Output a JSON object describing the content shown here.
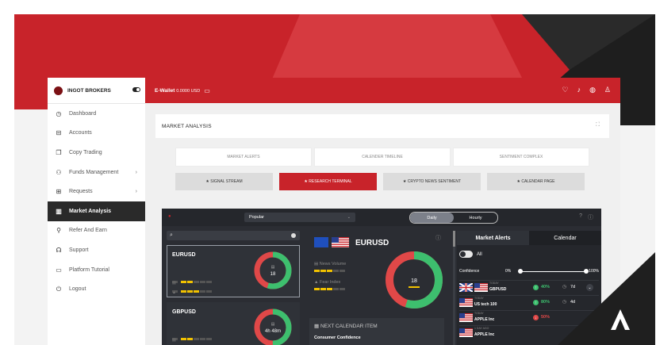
{
  "colors": {
    "brand_red": "#c8232a",
    "dark": "#2b2d33",
    "green": "#3dbf6e",
    "red": "#e04848",
    "yellow": "#f2c200"
  },
  "brand": {
    "name": "INGOT BROKERS"
  },
  "sidebar": {
    "items": [
      {
        "label": "Dashboard",
        "icon": "dashboard-icon"
      },
      {
        "label": "Accounts",
        "icon": "accounts-icon"
      },
      {
        "label": "Copy Trading",
        "icon": "copy-icon"
      },
      {
        "label": "Funds Management",
        "icon": "funds-icon",
        "chevron": "›"
      },
      {
        "label": "Requests",
        "icon": "requests-icon",
        "chevron": "›"
      },
      {
        "label": "Market Analysis",
        "icon": "chart-icon"
      },
      {
        "label": "Refer And Earn",
        "icon": "refer-icon"
      },
      {
        "label": "Support",
        "icon": "support-icon"
      },
      {
        "label": "Platform Tutorial",
        "icon": "tutorial-icon"
      },
      {
        "label": "Logout",
        "icon": "logout-icon"
      }
    ],
    "active": "Market Analysis"
  },
  "topbar": {
    "wallet_label": "E-Wallet",
    "wallet_amount": "0.0000 USD"
  },
  "main": {
    "title": "MARKET ANALYSIS",
    "tabs_row1": [
      "MARKET ALERTS",
      "CALENDER TIMELINE",
      "SENTIMENT COMPLEX"
    ],
    "tabs_row2": [
      {
        "label": "★ SIGNAL STREAM"
      },
      {
        "label": "★ RESEARCH TERMINAL",
        "active": true
      },
      {
        "label": "★ CRYPTO NEWS SENTIMENT"
      },
      {
        "label": "★ CALENDAR PAGE"
      }
    ]
  },
  "terminal": {
    "select_value": "Popular",
    "toggle": [
      "Daily",
      "Hourly"
    ],
    "toggle_selected": "Daily",
    "pairs": [
      {
        "name": "EURUSD",
        "timer": "18",
        "timer_unit": "h",
        "ring_green": 0.55
      },
      {
        "name": "GBPUSD",
        "timer": "4h 48m",
        "ring_green": 0.5
      }
    ],
    "detail": {
      "pair": "EURUSD",
      "news_label": "News Volume",
      "fear_label": "Fear Index",
      "timer": "18",
      "timer_unit": "h",
      "ring_green": 0.55
    },
    "next_calendar": {
      "heading": "NEXT CALENDAR ITEM",
      "event": "Consumer Confidence"
    },
    "alerts_panel": {
      "tabs": [
        "Market Alerts",
        "Calendar"
      ],
      "active_tab": "Market Alerts",
      "all_label": "All",
      "confidence_label": "Confidence",
      "min": "0%",
      "max": "100%",
      "rows": [
        {
          "time": "TODAY",
          "symbol": "GBPUSD",
          "pct": "40%",
          "dir": "up",
          "duration": "7d",
          "flags": [
            "uk",
            "us"
          ]
        },
        {
          "time": "TODAY",
          "symbol": "US tech 100",
          "pct": "80%",
          "dir": "up",
          "duration": "4d",
          "flags": [
            "us"
          ]
        },
        {
          "time": "TODAY",
          "symbol": "APPLE Inc",
          "pct": "50%",
          "dir": "down",
          "duration": "",
          "flags": [
            "us"
          ]
        },
        {
          "time": "1 DAY AGO",
          "symbol": "APPLE Inc",
          "pct": "",
          "dir": "",
          "duration": "",
          "flags": [
            "us"
          ]
        }
      ]
    }
  }
}
